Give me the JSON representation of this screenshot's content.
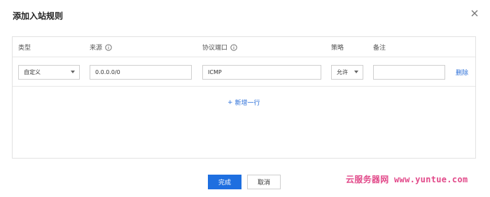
{
  "dialog": {
    "title": "添加入站规则",
    "close_icon": "close-icon"
  },
  "table": {
    "columns": [
      {
        "label": "类型"
      },
      {
        "label": "来源",
        "info_icon": "info-circle-icon"
      },
      {
        "label": "协议端口",
        "info_icon": "info-circle-icon"
      },
      {
        "label": "策略"
      },
      {
        "label": "备注"
      }
    ],
    "rows": [
      {
        "type": "自定义",
        "source": "0.0.0.0/0",
        "protocol_port": "ICMP",
        "policy": "允许",
        "remark": "",
        "delete_label": "删除"
      }
    ],
    "add_row_label": "新增一行",
    "add_row_prefix": "+"
  },
  "footer": {
    "confirm_label": "完成",
    "cancel_label": "取消"
  },
  "watermark": "云服务器网 www.yuntue.com",
  "colors": {
    "accent": "#1e6fe0",
    "link": "#2a6ed8",
    "watermark": "#e24a8a"
  }
}
